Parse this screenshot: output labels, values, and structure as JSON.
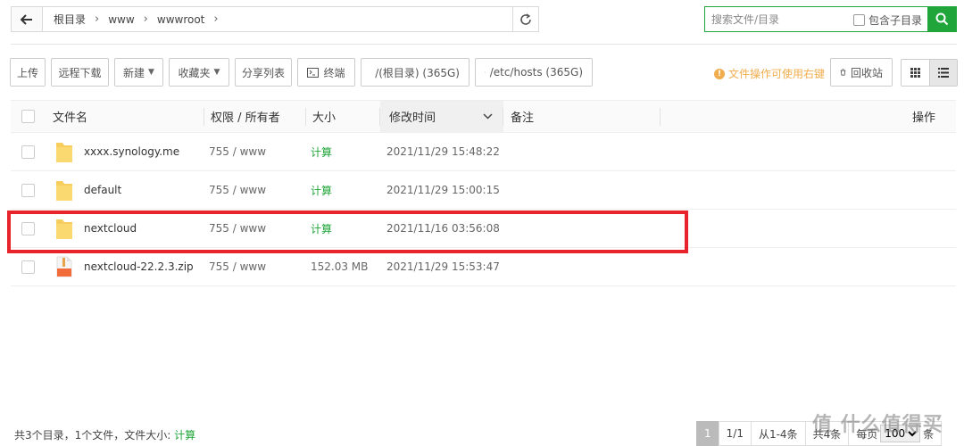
{
  "path": {
    "crumbs": [
      "根目录",
      "www",
      "wwwroot"
    ]
  },
  "search": {
    "placeholder": "搜索文件/目录",
    "subdir_label": "包含子目录"
  },
  "toolbar": {
    "upload": "上传",
    "remote_download": "远程下载",
    "new": "新建",
    "favorites": "收藏夹",
    "share_list": "分享列表",
    "terminal": "终端",
    "disk_root": "/(根目录) (365G)",
    "disk_hosts": "/etc/hosts (365G)"
  },
  "tip": "文件操作可使用右键",
  "recycle": "回收站",
  "table": {
    "headers": {
      "name": "文件名",
      "perm": "权限 / 所有者",
      "size": "大小",
      "mtime": "修改时间",
      "note": "备注",
      "ops": "操作"
    },
    "rows": [
      {
        "name": "xxxx.synology.me",
        "perm": "755 / www",
        "size": "计算",
        "mtime": "2021/11/29 15:48:22",
        "type": "folder"
      },
      {
        "name": "default",
        "perm": "755 / www",
        "size": "计算",
        "mtime": "2021/11/29 15:00:15",
        "type": "folder"
      },
      {
        "name": "nextcloud",
        "perm": "755 / www",
        "size": "计算",
        "mtime": "2021/11/16 03:56:08",
        "type": "folder"
      },
      {
        "name": "nextcloud-22.2.3.zip",
        "perm": "755 / www",
        "size": "152.03 MB",
        "mtime": "2021/11/29 15:53:47",
        "type": "zip"
      }
    ]
  },
  "footer": {
    "summary": "共3个目录，1个文件，文件大小:",
    "calc": "计算"
  },
  "pager": {
    "current": "1",
    "pages": "1/1",
    "range": "从1-4条",
    "total": "共4条",
    "per_page_label": "每页",
    "per_page": "100",
    "per_page_unit": "条"
  },
  "watermark": "值 什么值得买",
  "colors": {
    "accent": "#20a53a",
    "warning": "#f0ad4e",
    "highlight": "#e7232d"
  }
}
